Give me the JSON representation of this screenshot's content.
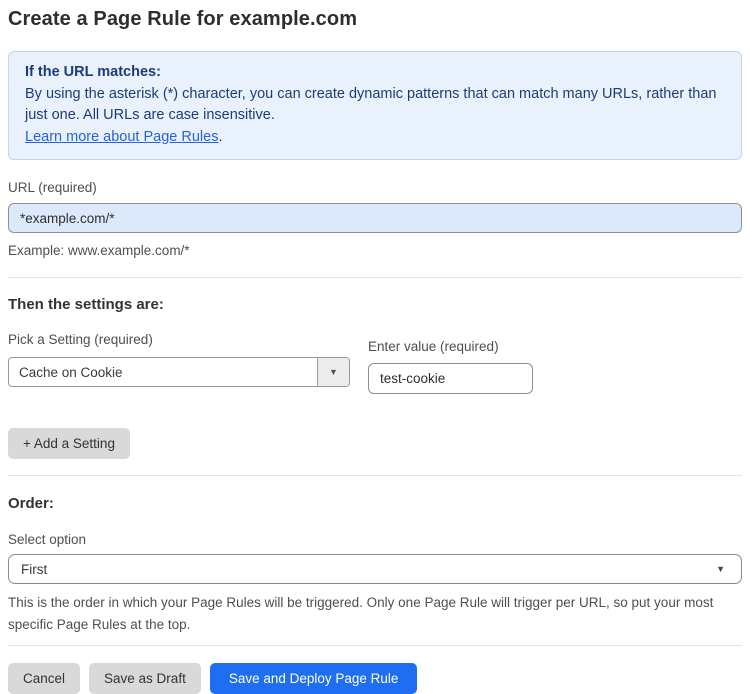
{
  "page": {
    "title": "Create a Page Rule for example.com"
  },
  "info_box": {
    "heading": "If the URL matches:",
    "body": "By using the asterisk (*) character, you can create dynamic patterns that can match many URLs, rather than just one. All URLs are case insensitive.",
    "link_label": "Learn more about Page Rules",
    "link_suffix": "."
  },
  "url_field": {
    "label": "URL (required)",
    "value": "*example.com/*",
    "helper": "Example: www.example.com/*"
  },
  "settings": {
    "heading": "Then the settings are:",
    "setting_label": "Pick a Setting (required)",
    "setting_selected": "Cache on Cookie",
    "value_label": "Enter value (required)",
    "value": "test-cookie",
    "add_button_label": "+ Add a Setting"
  },
  "order": {
    "heading": "Order:",
    "select_label": "Select option",
    "selected_option": "First",
    "helper": "This is the order in which your Page Rules will be triggered. Only one Page Rule will trigger per URL, so put your most specific Page Rules at the top."
  },
  "actions": {
    "cancel_label": "Cancel",
    "save_draft_label": "Save as Draft",
    "save_deploy_label": "Save and Deploy Page Rule"
  },
  "icons": {
    "chevron_down": "▼"
  },
  "colors": {
    "accent_blue": "#1f6ef2",
    "info_bg": "#e9f2fc",
    "info_border": "#bcd8f1",
    "info_text": "#1e3c74",
    "link_blue": "#2563d9",
    "url_input_bg": "#dce9fa",
    "button_gray": "#d9d9d9"
  }
}
